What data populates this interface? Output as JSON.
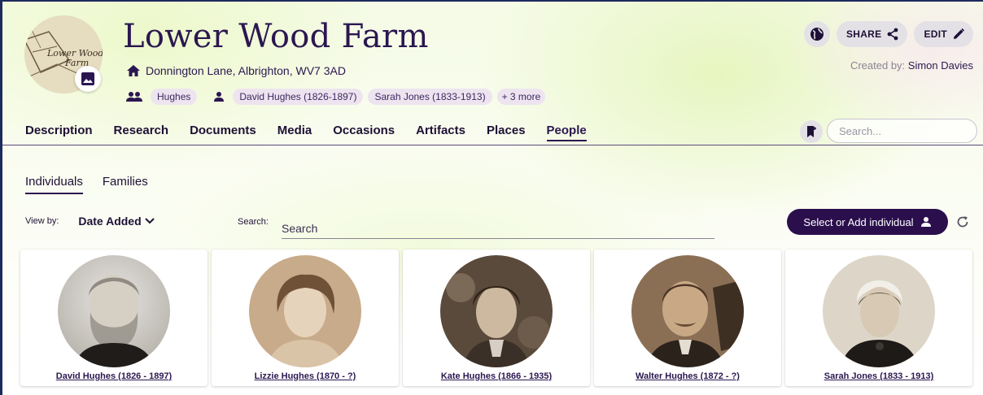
{
  "header": {
    "title": "Lower Wood Farm",
    "address": "Donnington Lane, Albrighton, WV7 3AD",
    "family_tag": "Hughes",
    "person_tags": [
      "David Hughes (1826-1897)",
      "Sarah Jones (1833-1913)"
    ],
    "more_tag": "+ 3 more",
    "avatar_text": "Lower Wood Farm",
    "created_by_label": "Created by:",
    "created_by_name": "Simon Davies",
    "share_label": "SHARE",
    "edit_label": "EDIT"
  },
  "nav": {
    "tabs": [
      "Description",
      "Research",
      "Documents",
      "Media",
      "Occasions",
      "Artifacts",
      "Places",
      "People"
    ],
    "active": "People",
    "search_placeholder": "Search..."
  },
  "people_view": {
    "subtabs": [
      "Individuals",
      "Families"
    ],
    "active_subtab": "Individuals",
    "view_by_label": "View by:",
    "view_by_value": "Date Added",
    "search_label": "Search:",
    "search_placeholder": "Search",
    "add_button_label": "Select or Add individual"
  },
  "individuals": [
    {
      "name": "David Hughes (1826 - 1897)"
    },
    {
      "name": "Lizzie Hughes (1870 - ?)"
    },
    {
      "name": "Kate Hughes (1866 - 1935)"
    },
    {
      "name": "Walter Hughes (1872 - ?)"
    },
    {
      "name": "Sarah Jones (1833 - 1913)"
    }
  ],
  "colors": {
    "brand_dark": "#2b0f4d",
    "text_primary": "#1e1035",
    "chip_bg": "#ede4f0"
  }
}
